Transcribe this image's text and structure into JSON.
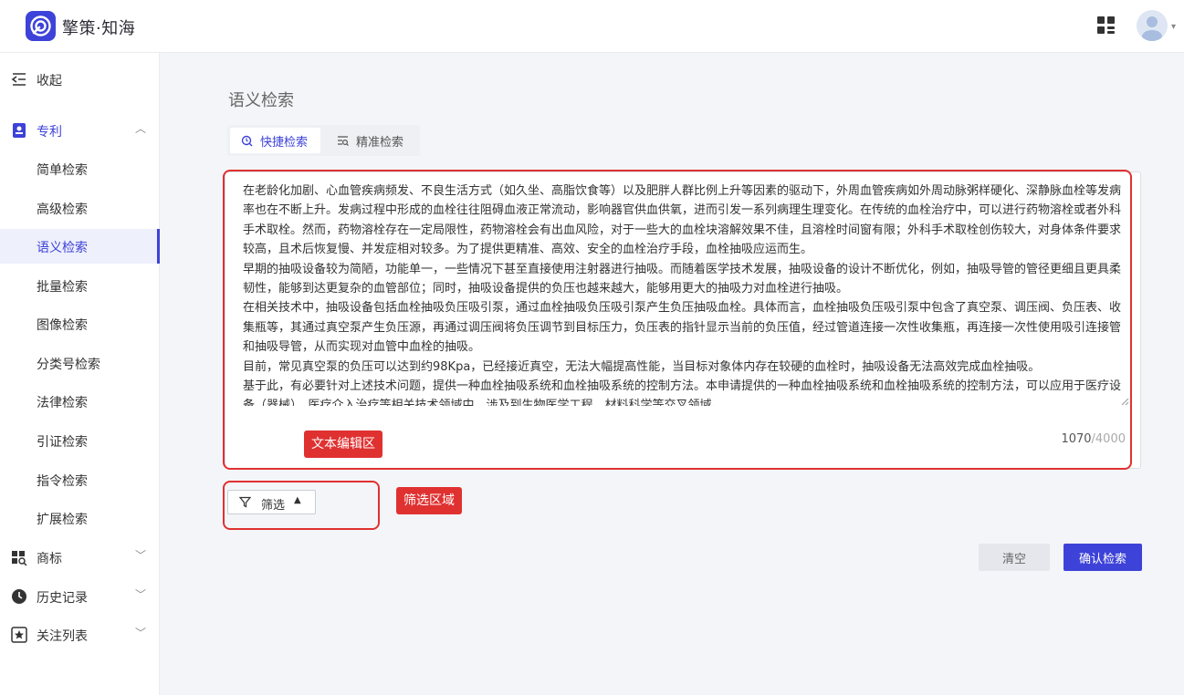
{
  "app": {
    "title": "擎策·知海"
  },
  "sidebar": {
    "collapse_label": "收起",
    "sections": [
      {
        "label": "专利",
        "expanded": true,
        "items": [
          "简单检索",
          "高级检索",
          "语义检索",
          "批量检索",
          "图像检索",
          "分类号检索",
          "法律检索",
          "引证检索",
          "指令检索",
          "扩展检索"
        ],
        "active_item": "语义检索"
      },
      {
        "label": "商标",
        "expanded": false
      },
      {
        "label": "历史记录",
        "expanded": false
      },
      {
        "label": "关注列表",
        "expanded": false
      }
    ]
  },
  "main": {
    "page_title": "语义检索",
    "tabs": [
      {
        "label": "快捷检索",
        "active": true,
        "icon": "quick-search-icon"
      },
      {
        "label": "精准检索",
        "active": false,
        "icon": "precise-search-icon"
      }
    ],
    "editor": {
      "paragraphs": [
        "在老龄化加剧、心血管疾病频发、不良生活方式（如久坐、高脂饮食等）以及肥胖人群比例上升等因素的驱动下，外周血管疾病如外周动脉粥样硬化、深静脉血栓等发病率也在不断上升。发病过程中形成的血栓往往阻碍血液正常流动，影响器官供血供氧，进而引发一系列病理生理变化。在传统的血栓治疗中，可以进行药物溶栓或者外科手术取栓。然而，药物溶栓存在一定局限性，药物溶栓会有出血风险，对于一些大的血栓块溶解效果不佳，且溶栓时间窗有限；外科手术取栓创伤较大，对身体条件要求较高，且术后恢复慢、并发症相对较多。为了提供更精准、高效、安全的血栓治疗手段，血栓抽吸应运而生。",
        "早期的抽吸设备较为简陋，功能单一，一些情况下甚至直接使用注射器进行抽吸。而随着医学技术发展，抽吸设备的设计不断优化，例如，抽吸导管的管径更细且更具柔韧性，能够到达更复杂的血管部位；同时，抽吸设备提供的负压也越来越大，能够用更大的抽吸力对血栓进行抽吸。",
        "在相关技术中，抽吸设备包括血栓抽吸负压吸引泵，通过血栓抽吸负压吸引泵产生负压抽吸血栓。具体而言，血栓抽吸负压吸引泵中包含了真空泵、调压阀、负压表、收集瓶等，其通过真空泵产生负压源，再通过调压阀将负压调节到目标压力，负压表的指针显示当前的负压值，经过管道连接一次性收集瓶，再连接一次性使用吸引连接管和抽吸导管，从而实现对血管中血栓的抽吸。",
        "目前，常见真空泵的负压可以达到约98Kpa，已经接近真空，无法大幅提高性能，当目标对象体内存在较硬的血栓时，抽吸设备无法高效完成血栓抽吸。",
        "基于此，有必要针对上述技术问题，提供一种血栓抽吸系统和血栓抽吸系统的控制方法。本申请提供的一种血栓抽吸系统和血栓抽吸系统的控制方法，可以应用于医疗设备（器械）、医疗介入治疗等相关技术领域中，涉及到生物医学工程、材料科学等交叉领域。"
      ],
      "char_count": "1070",
      "char_max": "/4000"
    },
    "annotations": {
      "editor_label": "文本编辑区",
      "filter_label": "筛选区域"
    },
    "filter": {
      "label": "筛选"
    },
    "buttons": {
      "clear": "清空",
      "confirm": "确认检索"
    }
  }
}
